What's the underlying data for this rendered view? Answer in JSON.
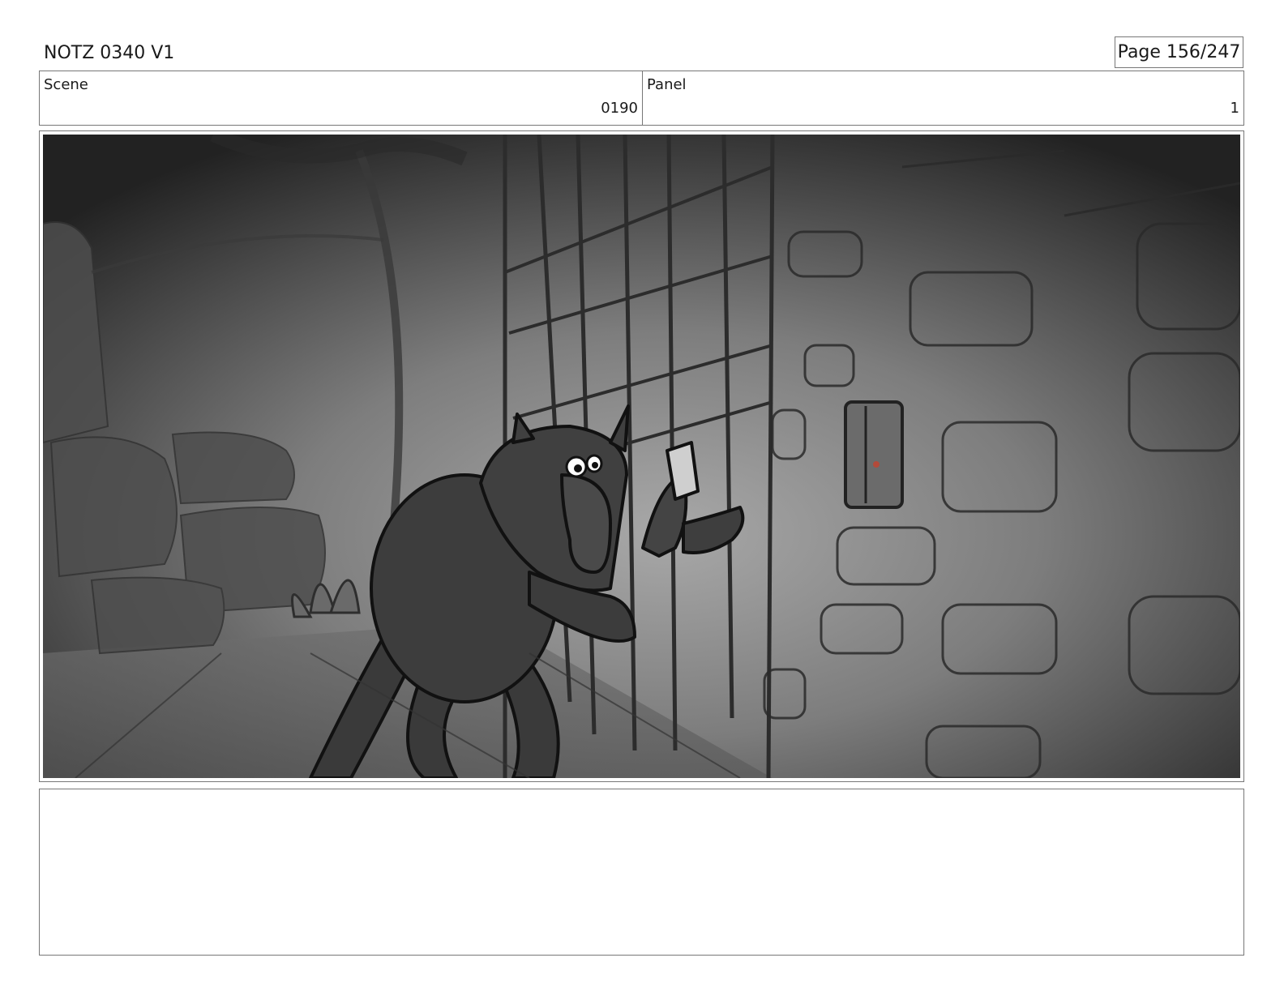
{
  "header": {
    "title": "NOTZ 0340 V1",
    "page": "Page 156/247"
  },
  "info": {
    "scene_label": "Scene",
    "scene_value": "0190",
    "panel_label": "Panel",
    "panel_value": "1"
  },
  "frame": {
    "image_subject": "storyboard-sketch-creature-at-gate"
  },
  "notes": {
    "text": ""
  }
}
